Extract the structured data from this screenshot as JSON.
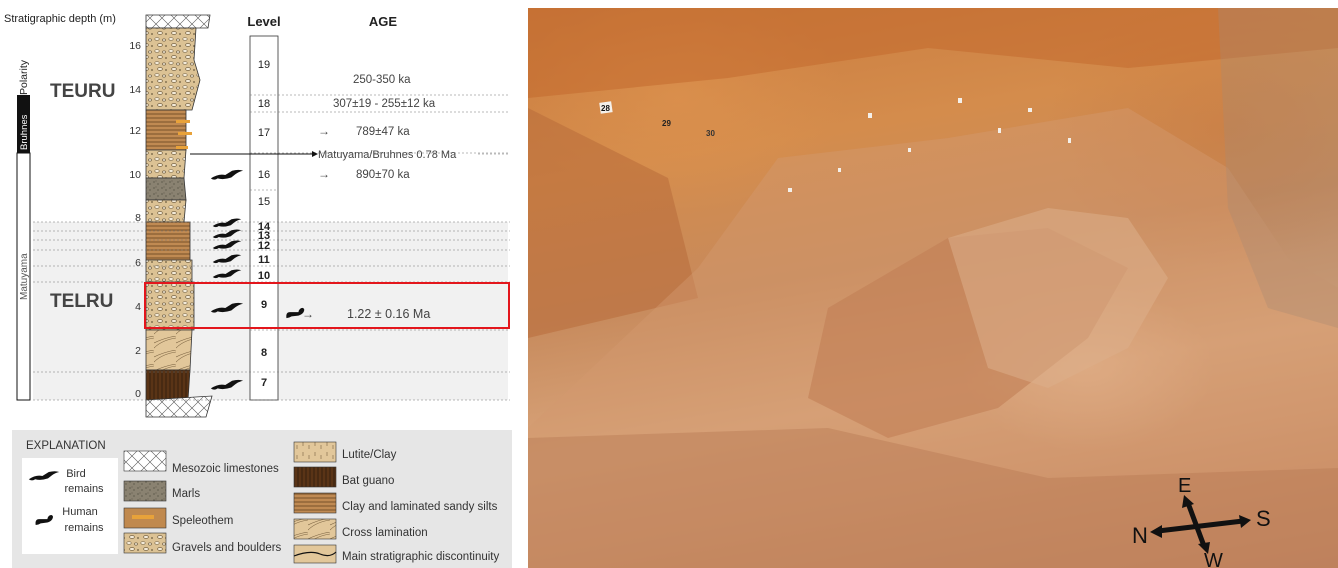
{
  "column": {
    "depth_axis_title": "Stratigraphic depth (m)",
    "depth_ticks": [
      "16",
      "14",
      "12",
      "10",
      "8",
      "6",
      "4",
      "2",
      "0"
    ],
    "polarity_title": "Polarity",
    "polarity_bruhnes": "Bruhnes",
    "polarity_matuyama": "Matuyama",
    "unit_upper": "TEURU",
    "unit_lower": "TELRU",
    "level_header": "Level",
    "age_header": "AGE",
    "levels": [
      {
        "label": "19",
        "bold": false
      },
      {
        "label": "18",
        "bold": false
      },
      {
        "label": "17",
        "bold": false
      },
      {
        "label": "16",
        "bold": false
      },
      {
        "label": "15",
        "bold": false
      },
      {
        "label": "14",
        "bold": true
      },
      {
        "label": "13",
        "bold": true
      },
      {
        "label": "12",
        "bold": true
      },
      {
        "label": "11",
        "bold": true
      },
      {
        "label": "10",
        "bold": true
      },
      {
        "label": "9",
        "bold": true
      },
      {
        "label": "8",
        "bold": true
      },
      {
        "label": "7",
        "bold": true
      }
    ],
    "ages": {
      "a19": "250-350 ka",
      "a18": "307±19 - 255±12 ka",
      "a17": "789±47 ka",
      "boundary": "Matuyama/Bruhnes 0.78 Ma",
      "a16": "890±70 ka",
      "a9": "1.22 ± 0.16 Ma"
    },
    "highlight_color": "#e3161c"
  },
  "legend": {
    "title": "EXPLANATION",
    "bird": "Bird\nremains",
    "bird_l1": "Bird",
    "bird_l2": "remains",
    "human_l1": "Human",
    "human_l2": "remains",
    "items": [
      "Mesozoic limestones",
      "Marls",
      "Speleothem",
      "Gravels and boulders",
      "Lutite/Clay",
      "Bat guano",
      "Clay and laminated sandy silts",
      "Cross lamination",
      "Main stratigraphic discontinuity"
    ]
  },
  "photo": {
    "compass": {
      "n": "N",
      "s": "S",
      "e": "E",
      "w": "W"
    },
    "tags": [
      "28",
      "29",
      "30"
    ]
  }
}
